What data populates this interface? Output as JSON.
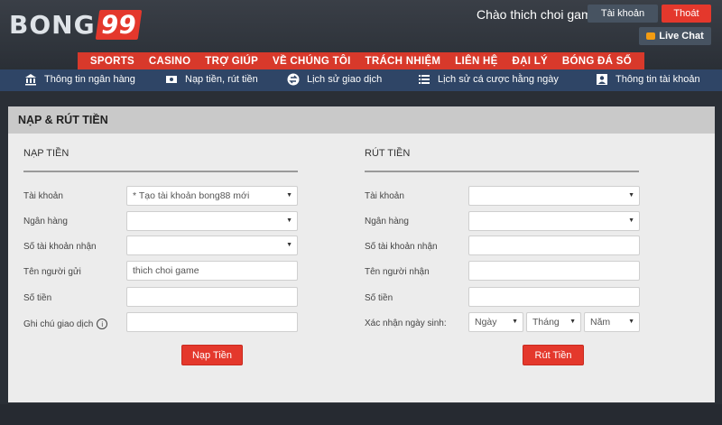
{
  "header": {
    "logo_text": "BONG",
    "logo_number": "99",
    "greeting": "Chào thich choi game",
    "account_button": "Tài khoản",
    "logout_button": "Thoát",
    "live_chat": "Live Chat"
  },
  "nav": [
    "SPORTS",
    "CASINO",
    "TRỢ GIÚP",
    "VỀ CHÚNG TÔI",
    "TRÁCH NHIỆM",
    "LIÊN HỆ",
    "ĐẠI LÝ",
    "BÓNG ĐÁ SỐ"
  ],
  "subnav": [
    {
      "label": "Thông tin ngân hàng",
      "icon": "bank-icon"
    },
    {
      "label": "Nạp tiền, rút tiền",
      "icon": "money-icon"
    },
    {
      "label": "Lịch sử giao dịch",
      "icon": "exchange-icon"
    },
    {
      "label": "Lịch sử cá cược hằng ngày",
      "icon": "list-icon"
    },
    {
      "label": "Thông tin tài khoản",
      "icon": "user-icon"
    }
  ],
  "panel": {
    "title": "NẠP & RÚT TIỀN",
    "deposit": {
      "title": "NẠP TIỀN",
      "labels": [
        "Tài khoản",
        "Ngân hàng",
        "Số tài khoản nhận",
        "Tên người gửi",
        "Số tiền",
        "Ghi chú giao dịch"
      ],
      "account_value": "* Tạo tài khoản bong88 mới",
      "sender_value": "thich choi game",
      "submit": "Nạp Tiền"
    },
    "withdraw": {
      "title": "RÚT TIỀN",
      "labels": [
        "Tài khoản",
        "Ngân hàng",
        "Số tài khoản nhận",
        "Tên người nhận",
        "Số tiền",
        "Xác nhận ngày sinh:"
      ],
      "day": "Ngày",
      "month": "Tháng",
      "year": "Năm",
      "submit": "Rút Tiền"
    }
  },
  "colors": {
    "accent": "#e4382c",
    "subnav": "#2f4566",
    "header": "#2a2f36"
  }
}
